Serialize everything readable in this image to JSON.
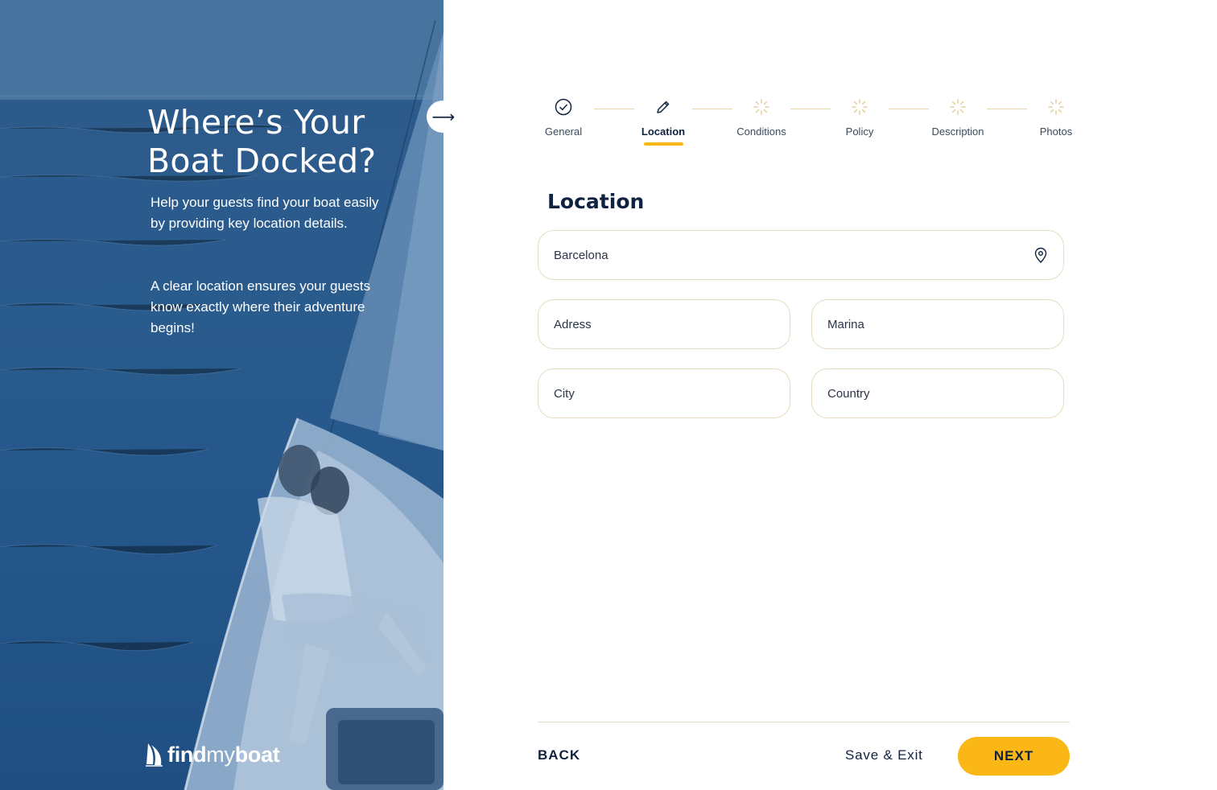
{
  "hero": {
    "title_line1": "Where’s Your",
    "title_line2": "Boat Docked?",
    "paragraph1": "Help your guests find your boat easily by providing key location details.",
    "paragraph2": "A clear location ensures your guests know exactly where their adventure begins!",
    "logo": {
      "part1": "find",
      "part2": "my",
      "part3": "boat",
      "icon": "sail-icon"
    },
    "collapse_arrow": "⟶"
  },
  "stepper": {
    "steps": [
      {
        "label": "General",
        "state": "complete",
        "icon": "check-circle-icon"
      },
      {
        "label": "Location",
        "state": "active",
        "icon": "pencil-icon"
      },
      {
        "label": "Conditions",
        "state": "pending",
        "icon": "spinner-icon"
      },
      {
        "label": "Policy",
        "state": "pending",
        "icon": "spinner-icon"
      },
      {
        "label": "Description",
        "state": "pending",
        "icon": "spinner-icon"
      },
      {
        "label": "Photos",
        "state": "pending",
        "icon": "spinner-icon"
      }
    ]
  },
  "form": {
    "title": "Location",
    "search": {
      "value": "Barcelona",
      "icon": "map-pin-icon"
    },
    "address": {
      "placeholder": "Adress"
    },
    "marina": {
      "placeholder": "Marina"
    },
    "city": {
      "placeholder": "City"
    },
    "country": {
      "placeholder": "Country"
    }
  },
  "footer": {
    "back_label": "BACK",
    "save_label": "Save & Exit",
    "next_label": "NEXT"
  },
  "colors": {
    "accent": "#fbb715",
    "navy": "#0f2240",
    "hero_blue": "#2a5b8d",
    "border": "#e6dcc0"
  }
}
